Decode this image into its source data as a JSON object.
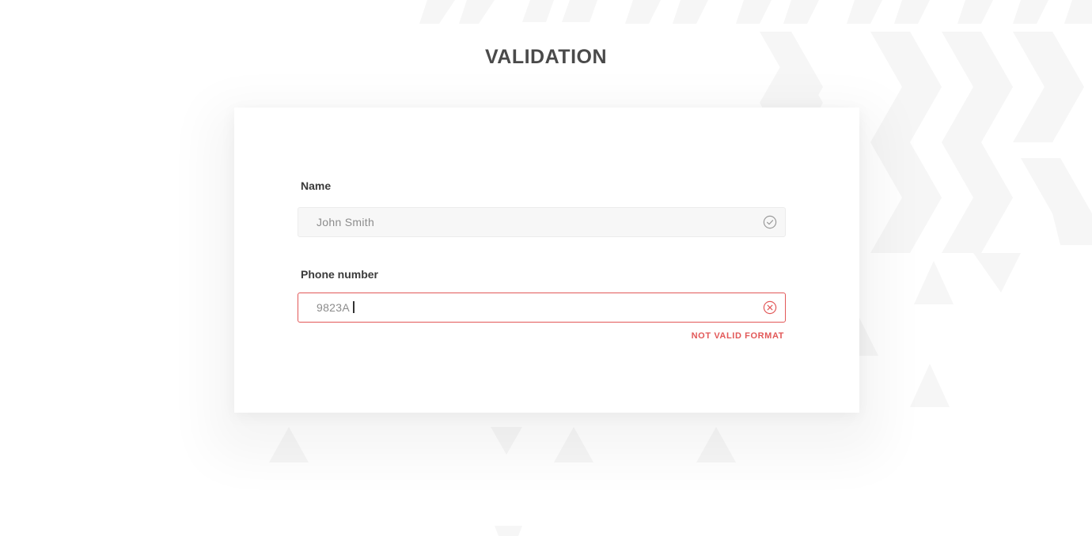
{
  "page": {
    "title": "VALIDATION"
  },
  "form": {
    "name_field": {
      "label": "Name",
      "value": "John Smith",
      "status": "valid",
      "status_icon": "check-circle-icon"
    },
    "phone_field": {
      "label": "Phone number",
      "value": "9823A",
      "status": "invalid",
      "status_icon": "x-circle-icon",
      "error_message": "NOT VALID FORMAT"
    }
  },
  "colors": {
    "error": "#e25858",
    "title": "#4a4a4a",
    "label": "#3a3a3a",
    "valid_icon": "#9a9a9a",
    "pattern": "#f6f6f6"
  }
}
